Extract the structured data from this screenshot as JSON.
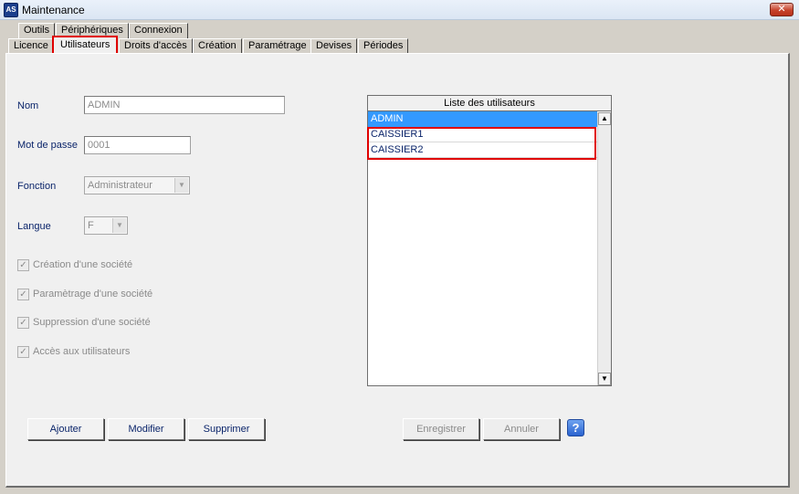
{
  "window": {
    "title": "Maintenance",
    "close_glyph": "✕",
    "icon_text": "AS"
  },
  "tabs_top": [
    {
      "label": "Outils"
    },
    {
      "label": "Périphériques"
    },
    {
      "label": "Connexion"
    }
  ],
  "tabs": [
    {
      "label": "Licence"
    },
    {
      "label": "Utilisateurs",
      "active": true
    },
    {
      "label": "Droits d'accès"
    },
    {
      "label": "Création"
    },
    {
      "label": "Paramétrage"
    },
    {
      "label": "Devises"
    },
    {
      "label": "Périodes"
    }
  ],
  "form": {
    "nom_label": "Nom",
    "nom_value": "ADMIN",
    "password_label": "Mot de passe",
    "password_value": "0001",
    "fonction_label": "Fonction",
    "fonction_value": "Administrateur",
    "langue_label": "Langue",
    "langue_value": "F"
  },
  "permissions": [
    {
      "label": "Création d'une société",
      "checked": true
    },
    {
      "label": "Paramètrage d'une société",
      "checked": true
    },
    {
      "label": "Suppression d'une société",
      "checked": true
    },
    {
      "label": "Accès aux utilisateurs",
      "checked": true
    }
  ],
  "user_list": {
    "header": "Liste des utilisateurs",
    "items": [
      "ADMIN",
      "CAISSIER1",
      "CAISSIER2"
    ],
    "selected": "ADMIN"
  },
  "buttons": {
    "add": "Ajouter",
    "modify": "Modifier",
    "delete": "Supprimer",
    "save": "Enregistrer",
    "cancel": "Annuler",
    "help": "?"
  },
  "icons": {
    "check": "✓",
    "dropdown": "▼",
    "scroll_up": "▲",
    "scroll_down": "▼"
  },
  "colors": {
    "highlight_red": "#e00000",
    "selection_blue": "#3399ff",
    "label_navy": "#0a246a"
  }
}
